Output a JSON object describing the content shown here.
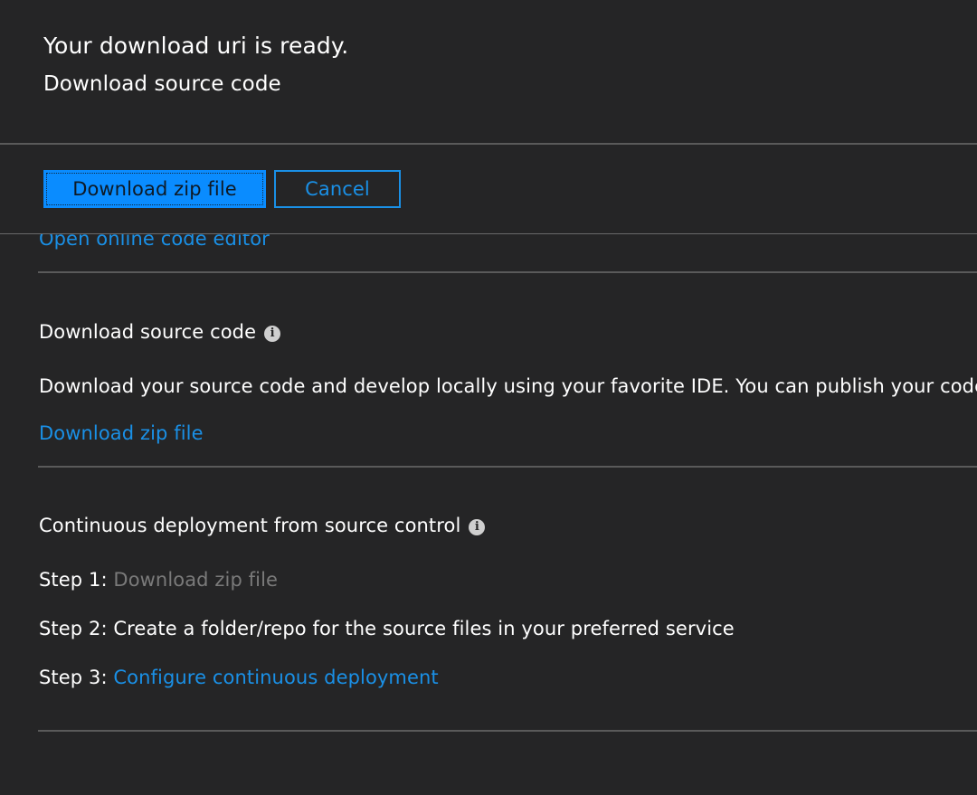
{
  "background_panel": {
    "open_editor_link": "Open online code editor",
    "download_section": {
      "title": "Download source code",
      "info_icon": "info-icon",
      "description": "Download your source code and develop locally using your favorite IDE. You can publish your code back to th",
      "download_link": "Download zip file"
    },
    "cd_section": {
      "title": "Continuous deployment from source control",
      "info_icon": "info-icon",
      "step1_prefix": "Step 1:",
      "step1_link": "Download zip file",
      "step2_text": "Step 2: Create a folder/repo for the source files in your preferred service",
      "step3_prefix": "Step 3:",
      "step3_link": "Configure continuous deployment"
    }
  },
  "dialog": {
    "title": "Your download uri is ready.",
    "subtitle": "Download source code",
    "primary_button": "Download zip file",
    "secondary_button": "Cancel"
  },
  "colors": {
    "background": "#252526",
    "accent_link": "#1a90e6",
    "primary_button": "#0a8cff",
    "text": "#ffffff",
    "disabled_text": "#7a7a7a",
    "divider": "#5a5a5a"
  }
}
